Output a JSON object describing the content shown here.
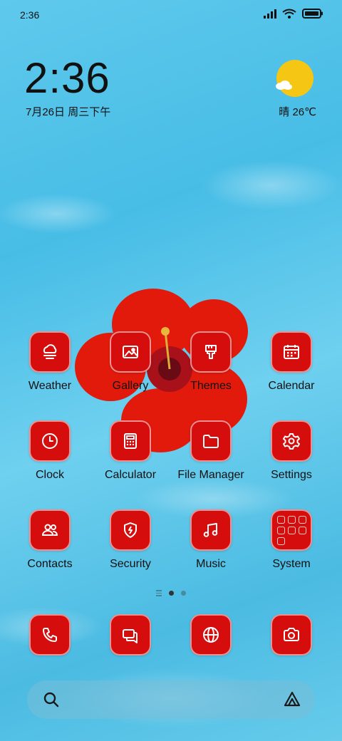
{
  "status_bar": {
    "time": "2:36"
  },
  "clock_widget": {
    "time": "2:36",
    "date": "7月26日 周三下午"
  },
  "weather_widget": {
    "temperature": "晴 26℃",
    "icon": "sun-cloud-icon"
  },
  "apps": [
    {
      "label": "Weather",
      "icon": "cloud-sun-icon"
    },
    {
      "label": "Gallery",
      "icon": "image-icon"
    },
    {
      "label": "Themes",
      "icon": "brush-icon"
    },
    {
      "label": "Calendar",
      "icon": "calendar-icon"
    },
    {
      "label": "Clock",
      "icon": "clock-icon"
    },
    {
      "label": "Calculator",
      "icon": "calculator-icon"
    },
    {
      "label": "File Manager",
      "icon": "folder-icon"
    },
    {
      "label": "Settings",
      "icon": "gear-icon"
    },
    {
      "label": "Contacts",
      "icon": "contacts-icon"
    },
    {
      "label": "Security",
      "icon": "shield-icon"
    },
    {
      "label": "Music",
      "icon": "music-note-icon"
    },
    {
      "label": "System",
      "icon": "folder-grid-icon"
    }
  ],
  "dock": [
    {
      "icon": "phone-icon"
    },
    {
      "icon": "message-icon"
    },
    {
      "icon": "browser-globe-icon"
    },
    {
      "icon": "camera-icon"
    }
  ],
  "pager": {
    "pages": 2,
    "current": 1
  },
  "colors": {
    "tile": "#d60d0d",
    "sun": "#f6c615",
    "water": "#47bde6"
  }
}
